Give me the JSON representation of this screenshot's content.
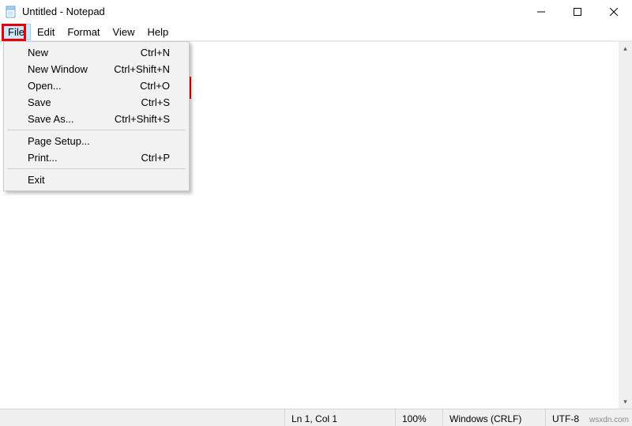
{
  "title": "Untitled - Notepad",
  "menubar": [
    "File",
    "Edit",
    "Format",
    "View",
    "Help"
  ],
  "file_menu": {
    "items": [
      {
        "label": "New",
        "shortcut": "Ctrl+N"
      },
      {
        "label": "New Window",
        "shortcut": "Ctrl+Shift+N"
      },
      {
        "label": "Open...",
        "shortcut": "Ctrl+O"
      },
      {
        "label": "Save",
        "shortcut": "Ctrl+S"
      },
      {
        "label": "Save As...",
        "shortcut": "Ctrl+Shift+S"
      }
    ],
    "items2": [
      {
        "label": "Page Setup...",
        "shortcut": ""
      },
      {
        "label": "Print...",
        "shortcut": "Ctrl+P"
      }
    ],
    "items3": [
      {
        "label": "Exit",
        "shortcut": ""
      }
    ]
  },
  "status": {
    "pos": "Ln 1, Col 1",
    "zoom": "100%",
    "eol": "Windows (CRLF)",
    "enc": "UTF-8"
  },
  "watermark": "wsxdn.com"
}
